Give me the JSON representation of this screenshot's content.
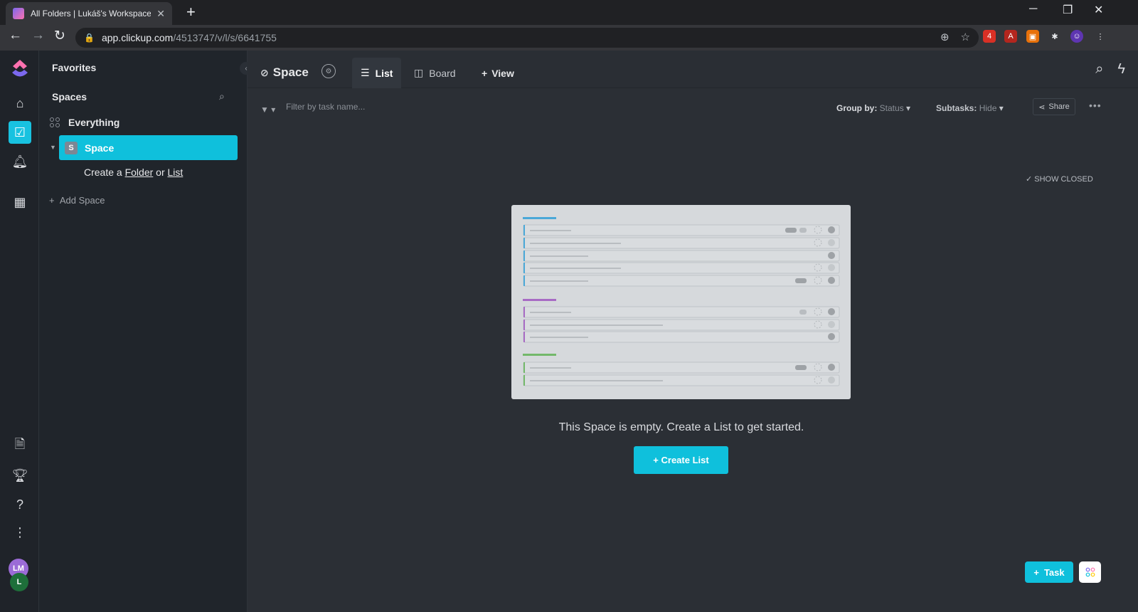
{
  "browser": {
    "tab_title": "All Folders | Lukáš's Workspace (",
    "url_host": "app.clickup.com",
    "url_path": "/4513747/v/l/s/6641755",
    "ext_badge": "4"
  },
  "sidebar": {
    "favorites": "Favorites",
    "spaces": "Spaces",
    "everything": "Everything",
    "space_initial": "S",
    "space_name": "Space",
    "create_prefix": "Create a",
    "create_folder": "Folder",
    "create_or": "or",
    "create_list": "List",
    "add_space": "Add Space"
  },
  "header": {
    "space_name": "Space",
    "tabs": [
      {
        "label": "List"
      },
      {
        "label": "Board"
      },
      {
        "label": "View"
      }
    ]
  },
  "filter": {
    "placeholder": "Filter by task name...",
    "group_by_label": "Group by:",
    "group_by_value": "Status",
    "subtasks_label": "Subtasks:",
    "subtasks_value": "Hide",
    "share": "Share",
    "show_closed": "SHOW CLOSED"
  },
  "empty_state": {
    "message": "This Space is empty. Create a List to get started.",
    "button": "+ Create List"
  },
  "fab": {
    "task": "Task"
  },
  "user": {
    "initials_1": "LM",
    "initials_2": "L"
  },
  "colors": {
    "accent": "#0fc0dc",
    "group_blue": "#4aa8d8",
    "group_purple": "#a86bc4",
    "group_green": "#73b86a"
  }
}
